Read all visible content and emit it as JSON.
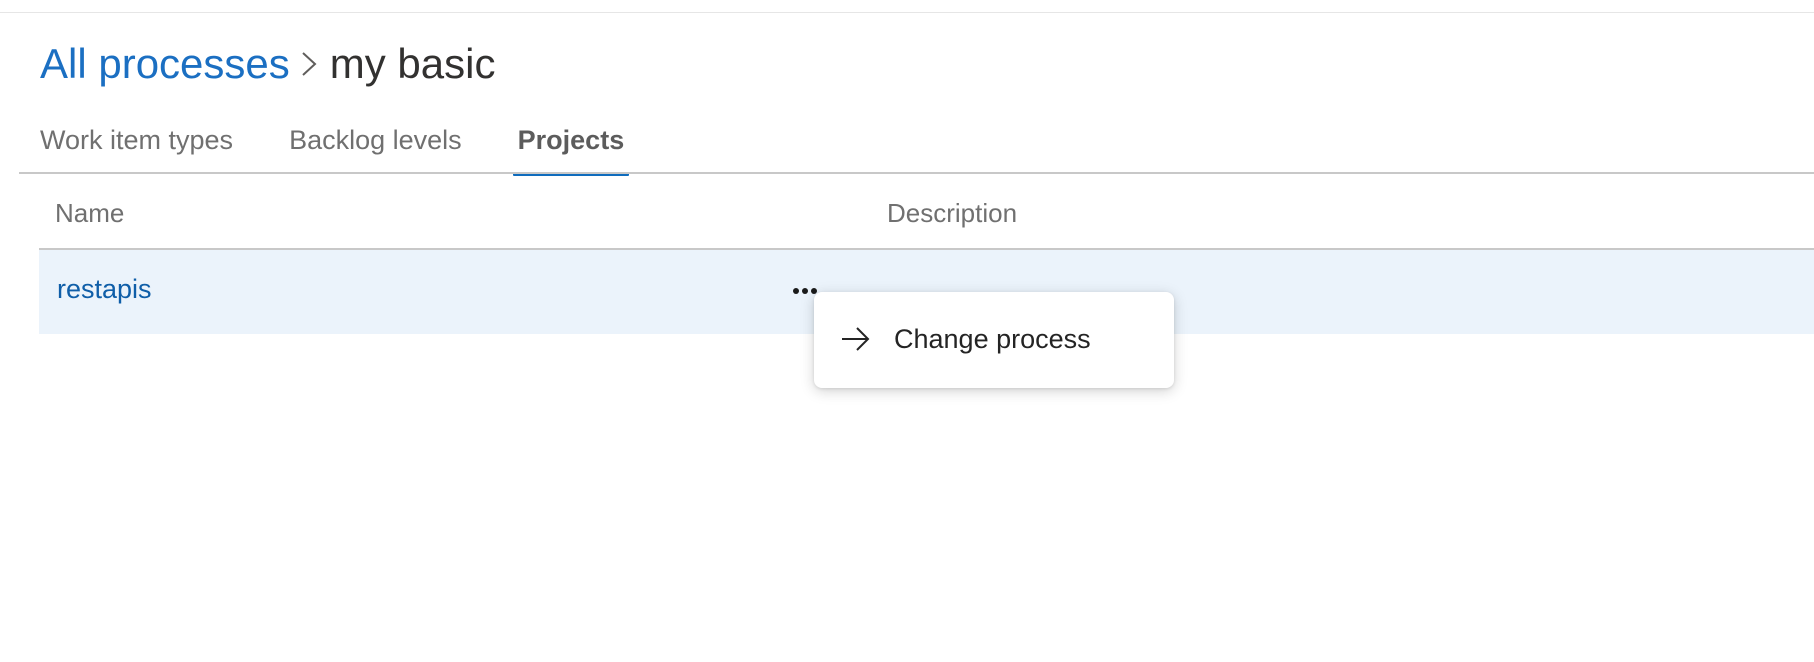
{
  "breadcrumb": {
    "parent_label": "All processes",
    "current_label": "my basic"
  },
  "tabs": [
    {
      "label": "Work item types",
      "active": false
    },
    {
      "label": "Backlog levels",
      "active": false
    },
    {
      "label": "Projects",
      "active": true
    }
  ],
  "table": {
    "columns": [
      "Name",
      "Description"
    ],
    "rows": [
      {
        "name": "restapis",
        "description": ""
      }
    ]
  },
  "context_menu": {
    "items": [
      {
        "label": "Change process",
        "icon": "arrow-right-icon"
      }
    ]
  },
  "colors": {
    "link": "#1b6fc2",
    "accent": "#0f6cbd",
    "row_highlight": "#ebf3fb"
  }
}
